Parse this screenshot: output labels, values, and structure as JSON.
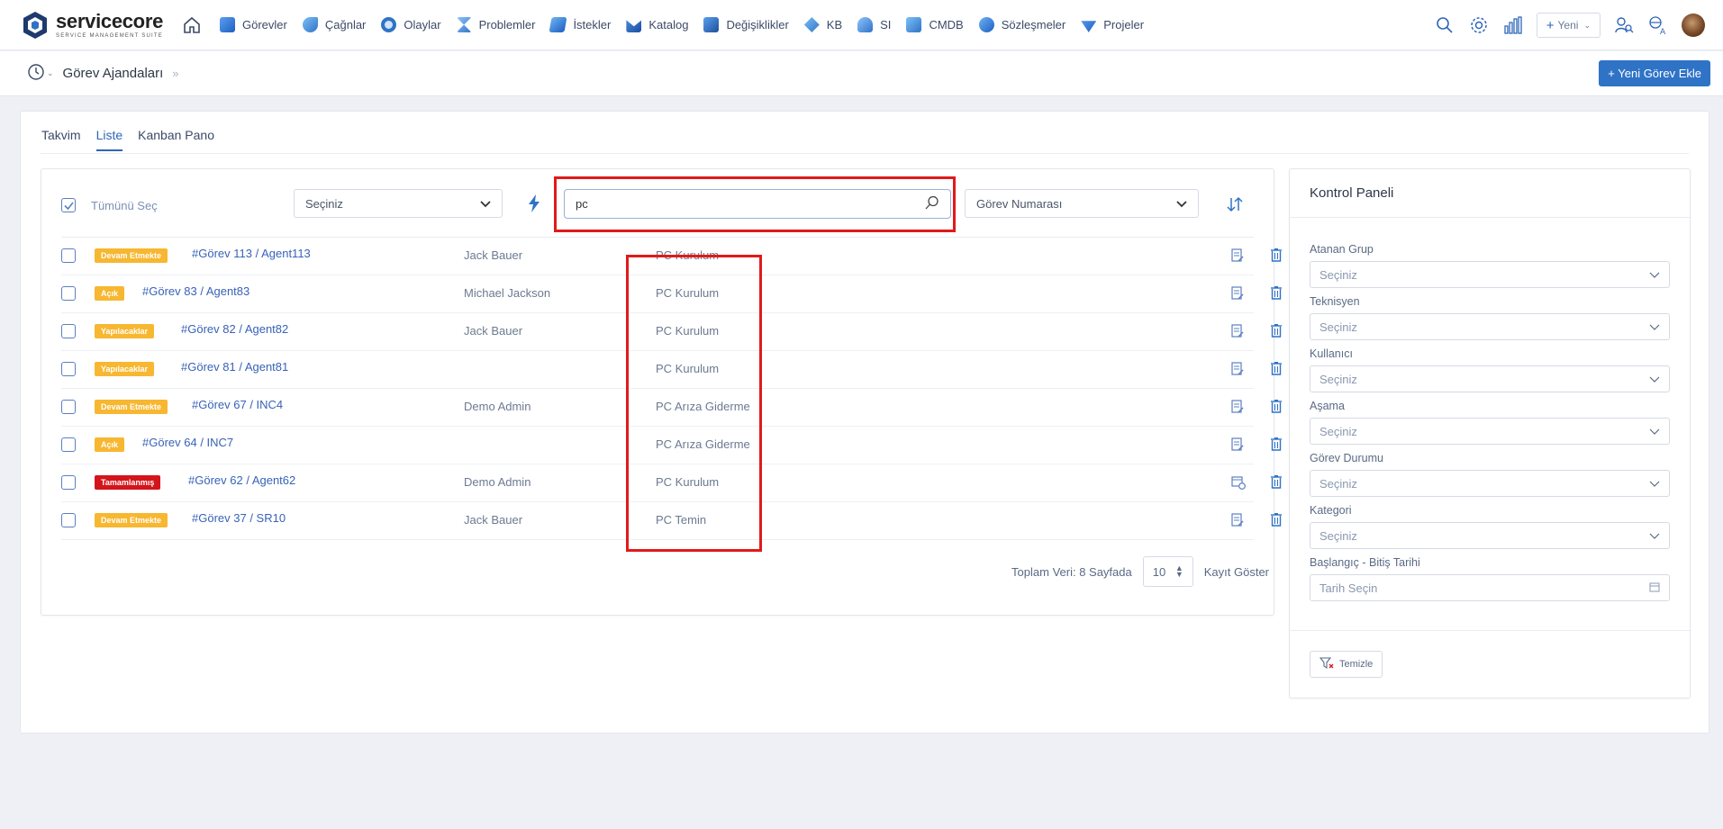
{
  "brand": {
    "name": "servicecore",
    "tagline": "SERVICE MANAGEMENT SUITE"
  },
  "nav": {
    "items": [
      {
        "label": "Görevler",
        "icon": "tasks-icon",
        "color": "#2f73c6"
      },
      {
        "label": "Çağnlar",
        "icon": "calls-icon",
        "color": "#2f73c6"
      },
      {
        "label": "Olaylar",
        "icon": "incidents-icon",
        "color": "#2f73c6"
      },
      {
        "label": "Problemler",
        "icon": "problems-icon",
        "color": "#2f73c6"
      },
      {
        "label": "İstekler",
        "icon": "requests-icon",
        "color": "#2f73c6"
      },
      {
        "label": "Katalog",
        "icon": "catalog-icon",
        "color": "#2f73c6"
      },
      {
        "label": "Değişiklikler",
        "icon": "changes-icon",
        "color": "#2f73c6"
      },
      {
        "label": "KB",
        "icon": "kb-icon",
        "color": "#2f73c6"
      },
      {
        "label": "SI",
        "icon": "si-icon",
        "color": "#2f73c6"
      },
      {
        "label": "CMDB",
        "icon": "cmdb-icon",
        "color": "#2f73c6"
      },
      {
        "label": "Sözleşmeler",
        "icon": "contracts-icon",
        "color": "#2f73c6"
      },
      {
        "label": "Projeler",
        "icon": "projects-icon",
        "color": "#2f73c6"
      }
    ],
    "new_button": "Yeni"
  },
  "header": {
    "title": "Görev Ajandaları",
    "add_button": "+ Yeni Görev Ekle"
  },
  "tabs": [
    {
      "label": "Takvim"
    },
    {
      "label": "Liste"
    },
    {
      "label": "Kanban Pano"
    }
  ],
  "filters": {
    "select_all": "Tümünü Seç",
    "group_select": "Seçiniz",
    "search_value": "pc",
    "sort_select": "Görev Numarası"
  },
  "rows": [
    {
      "status": "Devam Etmekte",
      "status_color": "#f7b731",
      "task": "#Görev 113 / Agent113",
      "assignee": "Jack Bauer",
      "category": "PC Kurulum"
    },
    {
      "status": "Açık",
      "status_color": "#f7b731",
      "task": "#Görev 83 / Agent83",
      "assignee": "Michael Jackson",
      "category": "PC Kurulum"
    },
    {
      "status": "Yapılacaklar",
      "status_color": "#f7b731",
      "task": "#Görev 82 / Agent82",
      "assignee": "Jack Bauer",
      "category": "PC Kurulum"
    },
    {
      "status": "Yapılacaklar",
      "status_color": "#f7b731",
      "task": "#Görev 81 / Agent81",
      "assignee": "",
      "category": "PC Kurulum"
    },
    {
      "status": "Devam Etmekte",
      "status_color": "#f7b731",
      "task": "#Görev 67 / INC4",
      "assignee": "Demo Admin",
      "category": "PC Arıza Giderme"
    },
    {
      "status": "Açık",
      "status_color": "#f7b731",
      "task": "#Görev 64 / INC7",
      "assignee": "",
      "category": "PC Arıza Giderme"
    },
    {
      "status": "Tamamlanmış",
      "status_color": "#d4141b",
      "task": "#Görev 62 / Agent62",
      "assignee": "Demo Admin",
      "category": "PC Kurulum"
    },
    {
      "status": "Devam Etmekte",
      "status_color": "#f7b731",
      "task": "#Görev 37 / SR10",
      "assignee": "Jack Bauer",
      "category": "PC Temin"
    }
  ],
  "pager": {
    "total": "Toplam Veri: 8 Sayfada",
    "page_size": "10",
    "show_label": "Kayıt Göster"
  },
  "control_panel": {
    "title": "Kontrol Paneli",
    "fields": [
      {
        "label": "Atanan Grup",
        "value": "Seçiniz"
      },
      {
        "label": "Teknisyen",
        "value": "Seçiniz"
      },
      {
        "label": "Kullanıcı",
        "value": "Seçiniz"
      },
      {
        "label": "Aşama",
        "value": "Seçiniz"
      },
      {
        "label": "Görev Durumu",
        "value": "Seçiniz"
      },
      {
        "label": "Kategori",
        "value": "Seçiniz"
      }
    ],
    "date_label": "Başlangıç - Bitiş Tarihi",
    "date_placeholder": "Tarih Seçin",
    "clear_button": "Temizle"
  }
}
